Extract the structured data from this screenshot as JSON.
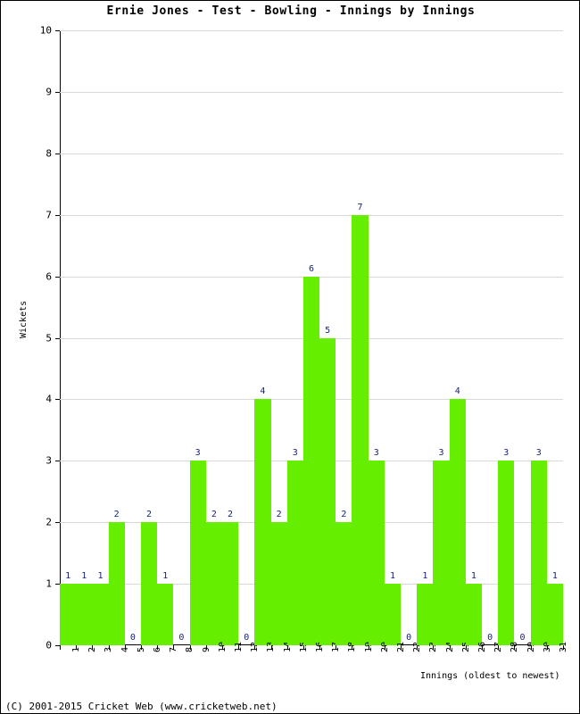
{
  "chart_data": {
    "type": "bar",
    "title": "Ernie Jones - Test - Bowling - Innings by Innings",
    "xlabel": "Innings (oldest to newest)",
    "ylabel": "Wickets",
    "ylim": [
      0,
      10
    ],
    "ytick_labels": [
      "0",
      "1",
      "2",
      "3",
      "4",
      "5",
      "6",
      "7",
      "8",
      "9",
      "10"
    ],
    "grid": true,
    "legend": false,
    "bar_color": "#66ee00",
    "value_label_color": "#131f7a",
    "gridline_color": "#d9d9d9",
    "categories": [
      "1",
      "2",
      "3",
      "4",
      "5",
      "6",
      "7",
      "8",
      "9",
      "10",
      "11",
      "12",
      "13",
      "14",
      "15",
      "16",
      "17",
      "18",
      "19",
      "20",
      "21",
      "22",
      "23",
      "24",
      "25",
      "26",
      "27",
      "28",
      "29",
      "30",
      "31"
    ],
    "values": [
      1,
      1,
      1,
      2,
      0,
      2,
      1,
      0,
      3,
      2,
      2,
      0,
      4,
      2,
      3,
      6,
      5,
      2,
      7,
      3,
      1,
      0,
      1,
      3,
      4,
      1,
      0,
      3,
      0,
      3,
      1
    ]
  },
  "footer": {
    "copyright": "(C) 2001-2015 Cricket Web (www.cricketweb.net)"
  }
}
